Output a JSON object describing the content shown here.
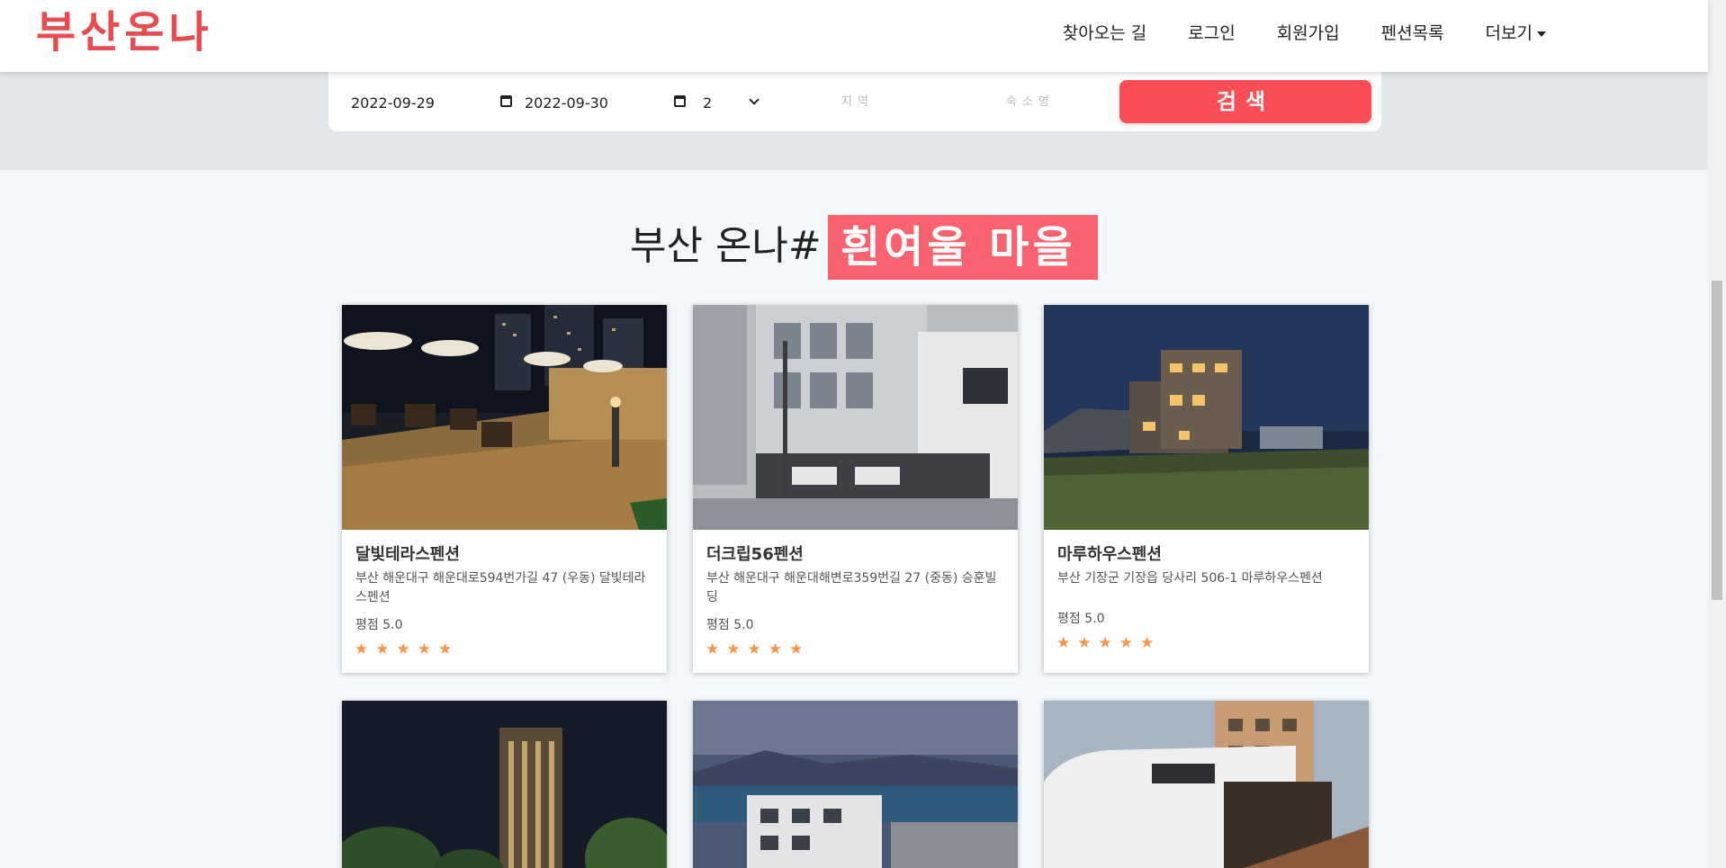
{
  "brand": {
    "logo": "부산온나",
    "accent": "#e84b50"
  },
  "nav": {
    "items": [
      {
        "label": "찾아오는 길"
      },
      {
        "label": "로그인"
      },
      {
        "label": "회원가입"
      },
      {
        "label": "펜션목록"
      },
      {
        "label": "더보기"
      }
    ]
  },
  "search": {
    "checkin": "2022-09-29",
    "checkout": "2022-09-30",
    "guests": "2",
    "region_placeholder": "지역",
    "lodging_placeholder": "숙소명",
    "button_label": "검색"
  },
  "section": {
    "title": "부산 온나#",
    "highlight": "흰여울 마을",
    "highlight_color": "#f96370"
  },
  "cards": [
    {
      "name": "달빛테라스펜션",
      "address": "부산 해운대구 해운대로594번가길 47 (우동) 달빛테라스펜션",
      "rating_text": "평점 5.0",
      "rating": 5
    },
    {
      "name": "더크립56펜션",
      "address": "부산 해운대구 해운대해변로359번길 27 (중동) 승훈빌딩",
      "rating_text": "평점 5.0",
      "rating": 5
    },
    {
      "name": "마루하우스펜션",
      "address": "부산 기장군 기장읍 당사리 506-1 마루하우스펜션",
      "rating_text": "평점 5.0",
      "rating": 5
    },
    {
      "name": "",
      "address": "",
      "rating_text": "",
      "rating": 0
    },
    {
      "name": "",
      "address": "",
      "rating_text": "",
      "rating": 0
    },
    {
      "name": "",
      "address": "",
      "rating_text": "",
      "rating": 0
    }
  ],
  "icons": {
    "calendar": "calendar-icon",
    "chevron": "chevron-down-icon",
    "star": "star-icon",
    "caret": "caret-down-icon"
  },
  "colors": {
    "search_button": "#fb4d56",
    "star": "#f7964a"
  }
}
